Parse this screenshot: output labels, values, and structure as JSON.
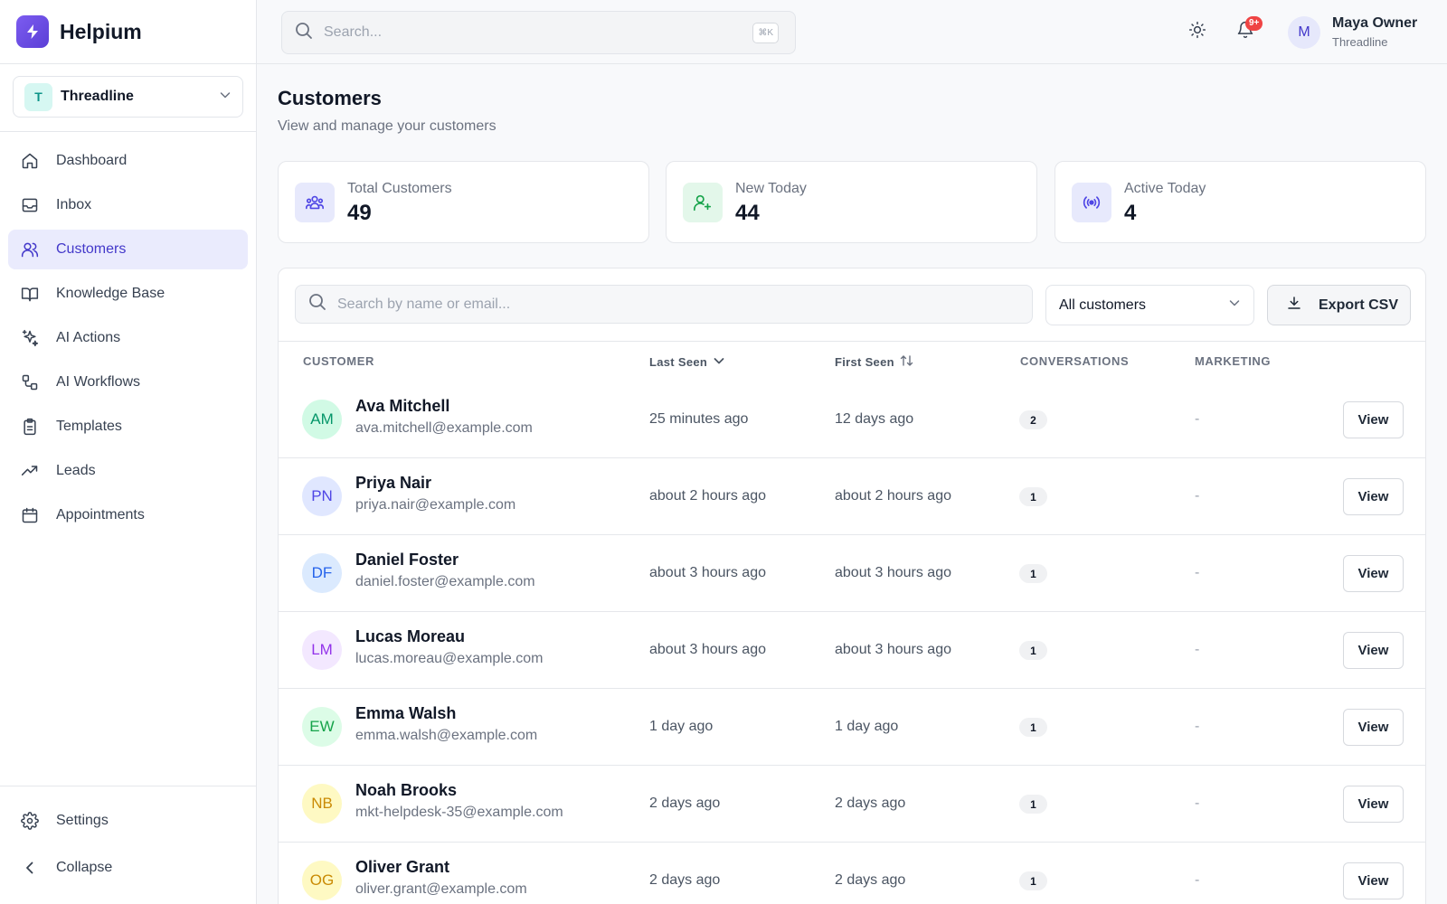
{
  "app": {
    "name": "Helpium",
    "workspace_initial": "T",
    "workspace_name": "Threadline"
  },
  "sidebar": {
    "items": [
      {
        "label": "Dashboard",
        "icon": "home-icon",
        "active": false
      },
      {
        "label": "Inbox",
        "icon": "inbox-icon",
        "active": false
      },
      {
        "label": "Customers",
        "icon": "users-icon",
        "active": true
      },
      {
        "label": "Knowledge Base",
        "icon": "book-icon",
        "active": false
      },
      {
        "label": "AI Actions",
        "icon": "sparkles-icon",
        "active": false
      },
      {
        "label": "AI Workflows",
        "icon": "workflow-icon",
        "active": false
      },
      {
        "label": "Templates",
        "icon": "clipboard-icon",
        "active": false
      },
      {
        "label": "Leads",
        "icon": "trending-up-icon",
        "active": false
      },
      {
        "label": "Appointments",
        "icon": "calendar-icon",
        "active": false
      }
    ],
    "settings_label": "Settings",
    "collapse_label": "Collapse"
  },
  "topbar": {
    "search_placeholder": "Search...",
    "shortcut": "⌘K",
    "notification_count": "9+",
    "user_initial": "M",
    "user_name": "Maya Owner",
    "user_org": "Threadline"
  },
  "page": {
    "title": "Customers",
    "subtitle": "View and manage your customers"
  },
  "stats": [
    {
      "label": "Total Customers",
      "value": "49",
      "icon": "users-icon"
    },
    {
      "label": "New Today",
      "value": "44",
      "icon": "user-plus-icon"
    },
    {
      "label": "Active Today",
      "value": "4",
      "icon": "radio-icon"
    }
  ],
  "table": {
    "search_placeholder": "Search by name or email...",
    "filter_value": "All customers",
    "export_label": "Export CSV",
    "columns": {
      "customer": "CUSTOMER",
      "last_seen": "Last Seen",
      "first_seen": "First Seen",
      "conversations": "CONVERSATIONS",
      "marketing": "MARKETING"
    },
    "view_label": "View",
    "rows": [
      {
        "initials": "AM",
        "name": "Ava Mitchell",
        "email": "ava.mitchell@example.com",
        "last_seen": "25 minutes ago",
        "first_seen": "12 days ago",
        "conversations": "2",
        "marketing": "-",
        "avatar_bg": "#d1fae5",
        "avatar_fg": "#059669"
      },
      {
        "initials": "PN",
        "name": "Priya Nair",
        "email": "priya.nair@example.com",
        "last_seen": "about 2 hours ago",
        "first_seen": "about 2 hours ago",
        "conversations": "1",
        "marketing": "-",
        "avatar_bg": "#e0e7ff",
        "avatar_fg": "#4f46e5"
      },
      {
        "initials": "DF",
        "name": "Daniel Foster",
        "email": "daniel.foster@example.com",
        "last_seen": "about 3 hours ago",
        "first_seen": "about 3 hours ago",
        "conversations": "1",
        "marketing": "-",
        "avatar_bg": "#dbeafe",
        "avatar_fg": "#2563eb"
      },
      {
        "initials": "LM",
        "name": "Lucas Moreau",
        "email": "lucas.moreau@example.com",
        "last_seen": "about 3 hours ago",
        "first_seen": "about 3 hours ago",
        "conversations": "1",
        "marketing": "-",
        "avatar_bg": "#f3e8ff",
        "avatar_fg": "#9333ea"
      },
      {
        "initials": "EW",
        "name": "Emma Walsh",
        "email": "emma.walsh@example.com",
        "last_seen": "1 day ago",
        "first_seen": "1 day ago",
        "conversations": "1",
        "marketing": "-",
        "avatar_bg": "#dcfce7",
        "avatar_fg": "#16a34a"
      },
      {
        "initials": "NB",
        "name": "Noah Brooks",
        "email": "mkt-helpdesk-35@example.com",
        "last_seen": "2 days ago",
        "first_seen": "2 days ago",
        "conversations": "1",
        "marketing": "-",
        "avatar_bg": "#fef9c3",
        "avatar_fg": "#ca8a04"
      },
      {
        "initials": "OG",
        "name": "Oliver Grant",
        "email": "oliver.grant@example.com",
        "last_seen": "2 days ago",
        "first_seen": "2 days ago",
        "conversations": "1",
        "marketing": "-",
        "avatar_bg": "#fef9c3",
        "avatar_fg": "#ca8a04"
      }
    ]
  },
  "colors": {
    "accent": "#4338ca",
    "active_bg": "#eaebfd",
    "brand": "#6d4ae6",
    "badge": "#ef4444"
  }
}
